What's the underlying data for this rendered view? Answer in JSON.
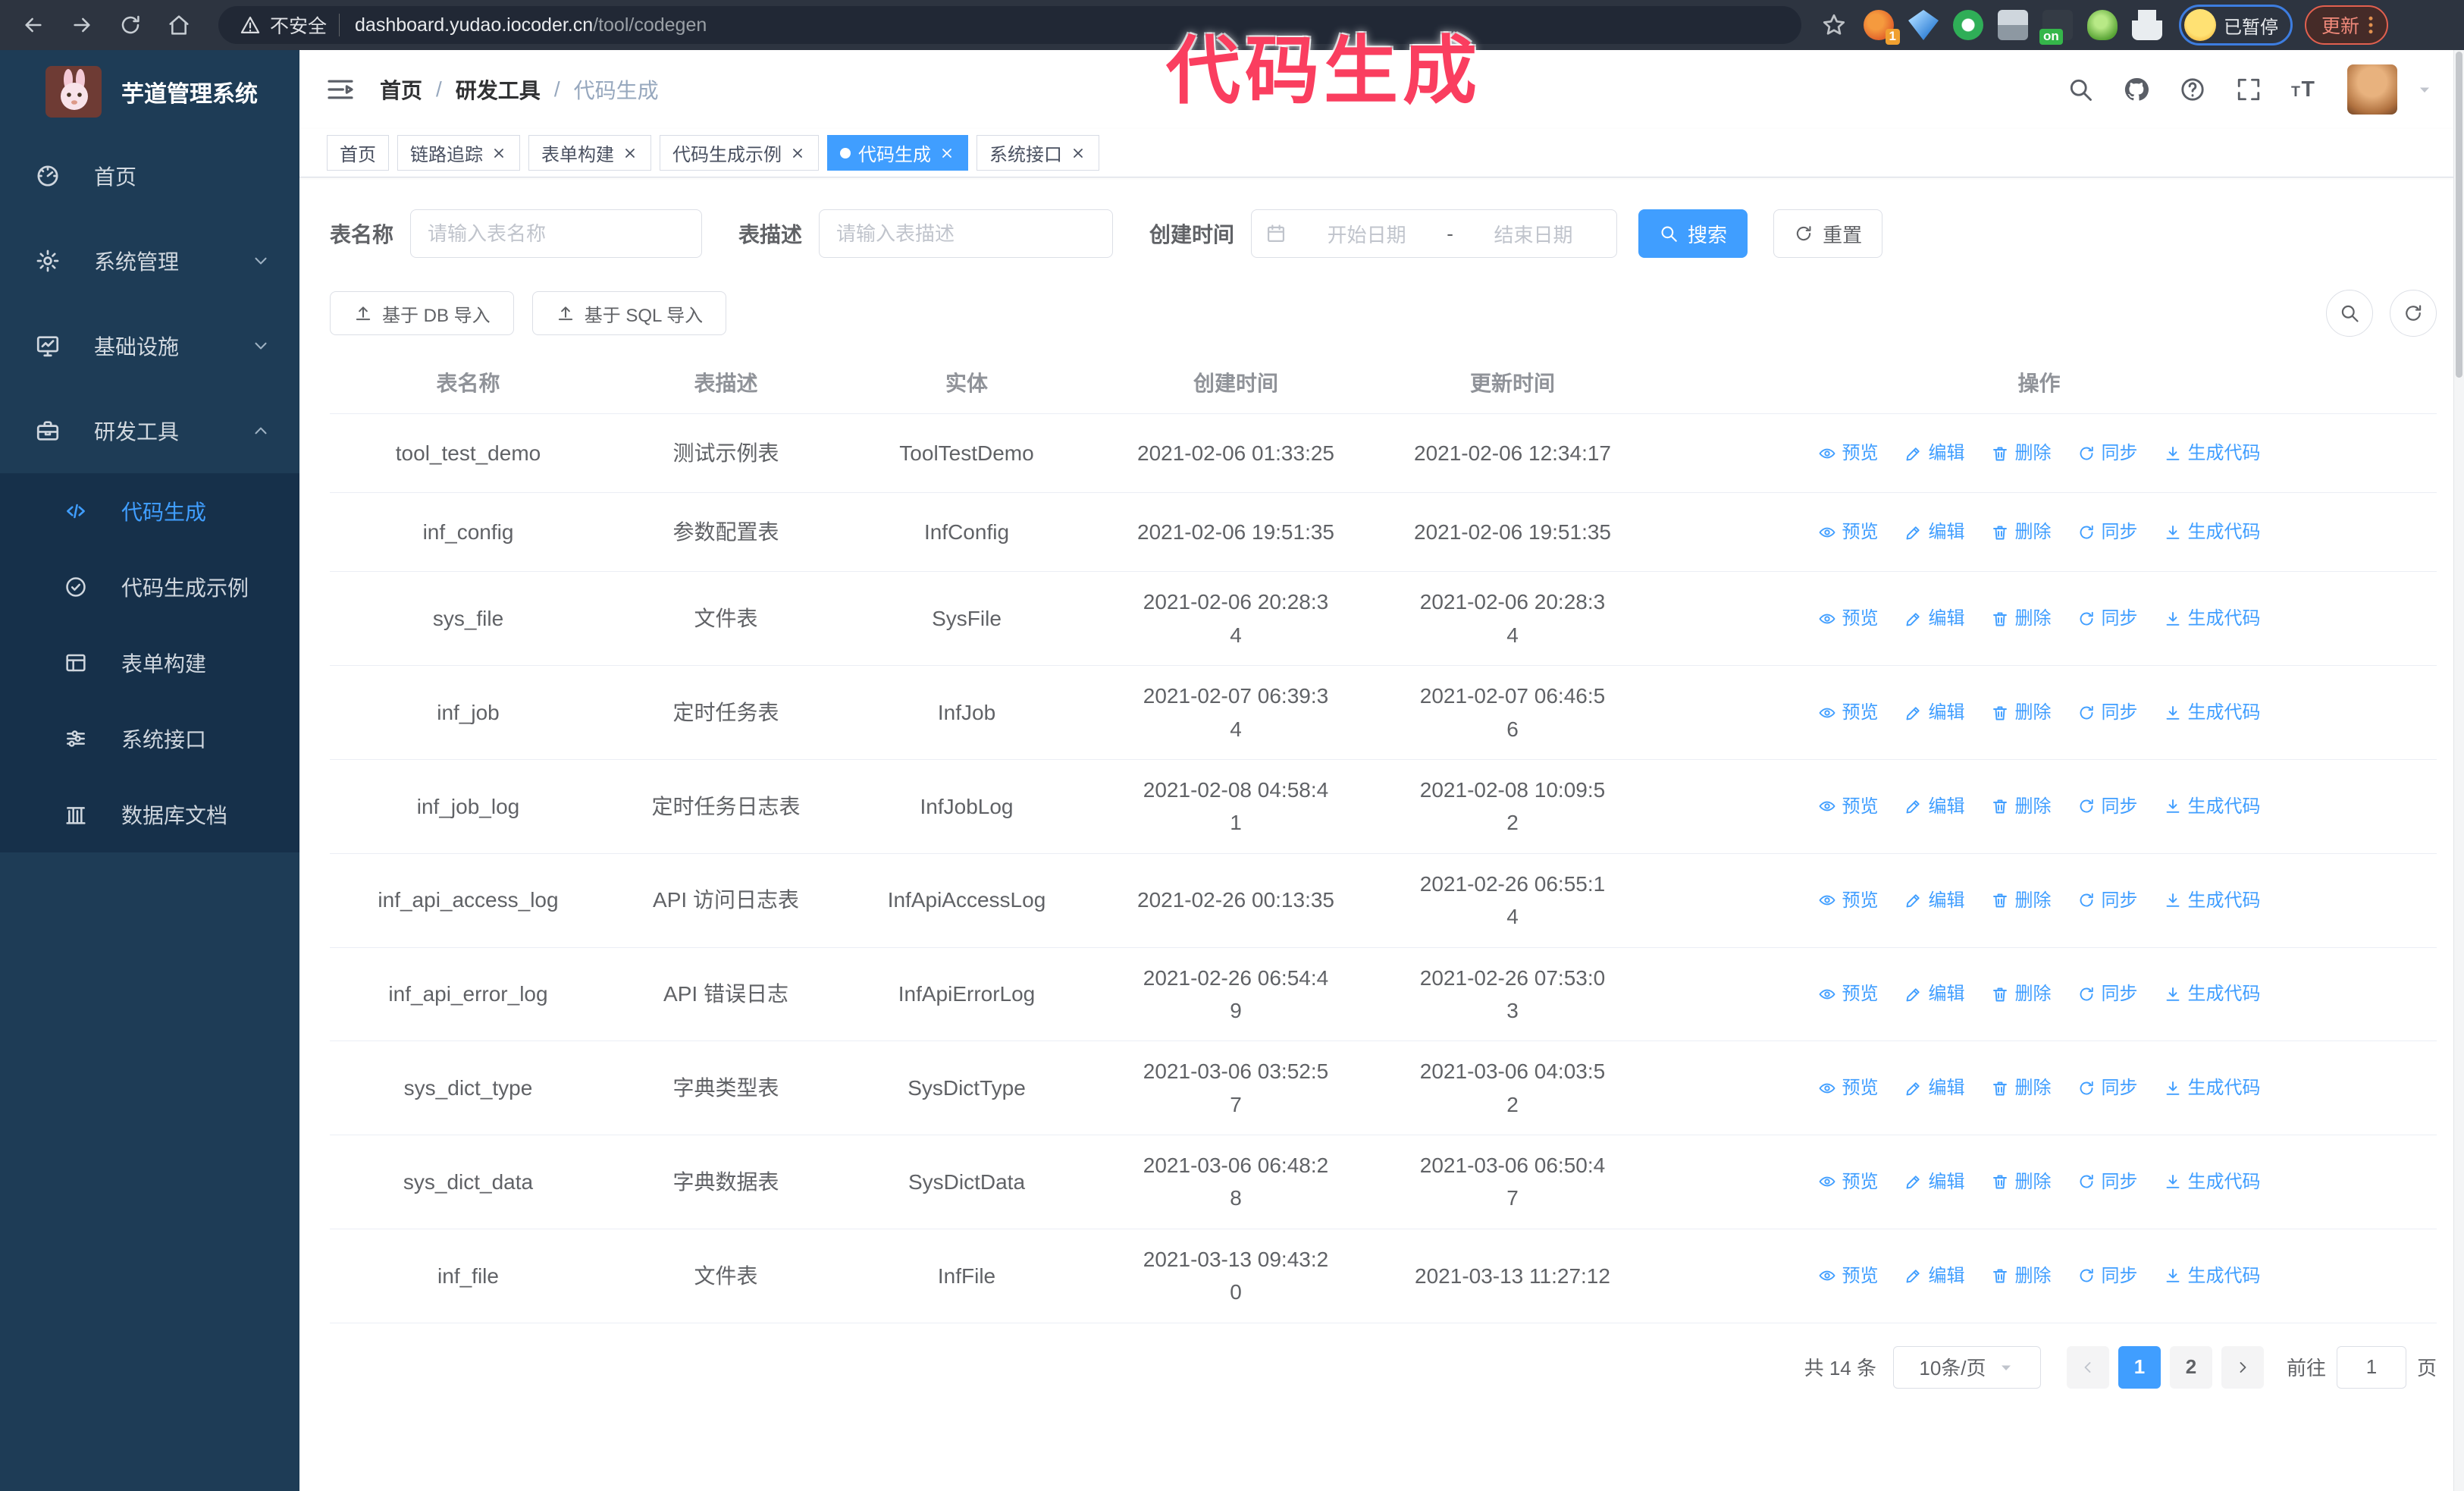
{
  "theme": {
    "accent": "#409eff",
    "annotation": "#fa3e5f",
    "sidebar_bg": "#1e3c56",
    "submenu_bg": "#16304a",
    "toolbar_bg": "#2d3440"
  },
  "annotation": {
    "text": "代码生成"
  },
  "browser": {
    "security_label": "不安全",
    "url_host": "dashboard.yudao.iocoder.cn",
    "url_path": "/tool/codegen",
    "extension_badge": "1",
    "extension_on_badge": "on",
    "paused_label": "已暂停",
    "update_label": "更新"
  },
  "sidebar": {
    "app_title": "芋道管理系统",
    "items": [
      {
        "label": "首页",
        "icon": "dashboard-icon",
        "name": "sidebar-item-home"
      },
      {
        "label": "系统管理",
        "icon": "gear-icon",
        "chevron_down": true,
        "name": "sidebar-item-system"
      },
      {
        "label": "基础设施",
        "icon": "monitor-icon",
        "chevron_down": true,
        "name": "sidebar-item-infra"
      },
      {
        "label": "研发工具",
        "icon": "toolbox-icon",
        "chevron_up": true,
        "name": "sidebar-item-devtools"
      }
    ],
    "sub_items": [
      {
        "label": "代码生成",
        "icon": "code-icon",
        "active": true,
        "name": "sidebar-item-codegen"
      },
      {
        "label": "代码生成示例",
        "icon": "badge-check-icon",
        "name": "sidebar-item-codegen-example"
      },
      {
        "label": "表单构建",
        "icon": "form-icon",
        "name": "sidebar-item-form-builder"
      },
      {
        "label": "系统接口",
        "icon": "sliders-icon",
        "name": "sidebar-item-api"
      },
      {
        "label": "数据库文档",
        "icon": "database-icon",
        "name": "sidebar-item-db-doc"
      }
    ]
  },
  "header": {
    "breadcrumb": [
      {
        "label": "首页",
        "first": true
      },
      {
        "label": "研发工具"
      },
      {
        "label": "代码生成",
        "current": true
      }
    ]
  },
  "tabs": [
    {
      "label": "首页"
    },
    {
      "label": "链路追踪",
      "closable": true
    },
    {
      "label": "表单构建",
      "closable": true
    },
    {
      "label": "代码生成示例",
      "closable": true
    },
    {
      "label": "代码生成",
      "closable": true,
      "active": true
    },
    {
      "label": "系统接口",
      "closable": true
    }
  ],
  "filters": {
    "table_name_label": "表名称",
    "table_name_placeholder": "请输入表名称",
    "table_desc_label": "表描述",
    "table_desc_placeholder": "请输入表描述",
    "create_time_label": "创建时间",
    "start_placeholder": "开始日期",
    "range_separator": "-",
    "end_placeholder": "结束日期",
    "search_label": "搜索",
    "reset_label": "重置"
  },
  "import_toolbar": {
    "db_label": "基于 DB 导入",
    "sql_label": "基于 SQL 导入"
  },
  "table": {
    "columns": [
      "表名称",
      "表描述",
      "实体",
      "创建时间",
      "更新时间",
      "操作"
    ],
    "actions": [
      {
        "name": "preview-action",
        "icon": "eye-icon",
        "label": "预览"
      },
      {
        "name": "edit-action",
        "icon": "edit-icon",
        "label": "编辑"
      },
      {
        "name": "delete-action",
        "icon": "delete-icon",
        "label": "删除"
      },
      {
        "name": "sync-action",
        "icon": "sync-icon",
        "label": "同步"
      },
      {
        "name": "generate-code-action",
        "icon": "download-icon",
        "label": "生成代码"
      }
    ],
    "rows": [
      {
        "name": "tool_test_demo",
        "desc": "测试示例表",
        "entity": "ToolTestDemo",
        "created": "2021-02-06 01:33:25",
        "updated": "2021-02-06 12:34:17"
      },
      {
        "name": "inf_config",
        "desc": "参数配置表",
        "entity": "InfConfig",
        "created": "2021-02-06 19:51:35",
        "updated": "2021-02-06 19:51:35"
      },
      {
        "name": "sys_file",
        "desc": "文件表",
        "entity": "SysFile",
        "created": [
          "2021-02-06 20:28:3",
          "4"
        ],
        "updated": [
          "2021-02-06 20:28:3",
          "4"
        ]
      },
      {
        "name": "inf_job",
        "desc": "定时任务表",
        "entity": "InfJob",
        "created": [
          "2021-02-07 06:39:3",
          "4"
        ],
        "updated": [
          "2021-02-07 06:46:5",
          "6"
        ]
      },
      {
        "name": "inf_job_log",
        "desc": "定时任务日志表",
        "entity": "InfJobLog",
        "created": [
          "2021-02-08 04:58:4",
          "1"
        ],
        "updated": [
          "2021-02-08 10:09:5",
          "2"
        ]
      },
      {
        "name": "inf_api_access_log",
        "desc": "API 访问日志表",
        "entity": "InfApiAccessLog",
        "created": "2021-02-26 00:13:35",
        "updated": [
          "2021-02-26 06:55:1",
          "4"
        ]
      },
      {
        "name": "inf_api_error_log",
        "desc": "API 错误日志",
        "entity": "InfApiErrorLog",
        "created": [
          "2021-02-26 06:54:4",
          "9"
        ],
        "updated": [
          "2021-02-26 07:53:0",
          "3"
        ]
      },
      {
        "name": "sys_dict_type",
        "desc": "字典类型表",
        "entity": "SysDictType",
        "created": [
          "2021-03-06 03:52:5",
          "7"
        ],
        "updated": [
          "2021-03-06 04:03:5",
          "2"
        ]
      },
      {
        "name": "sys_dict_data",
        "desc": "字典数据表",
        "entity": "SysDictData",
        "created": [
          "2021-03-06 06:48:2",
          "8"
        ],
        "updated": [
          "2021-03-06 06:50:4",
          "7"
        ]
      },
      {
        "name": "inf_file",
        "desc": "文件表",
        "entity": "InfFile",
        "created": [
          "2021-03-13 09:43:2",
          "0"
        ],
        "updated": "2021-03-13 11:27:12"
      }
    ]
  },
  "pagination": {
    "total_label": "共 14 条",
    "page_size_label": "10条/页",
    "pages": [
      {
        "label": "1",
        "active": true
      },
      {
        "label": "2"
      }
    ],
    "goto_label": "前往",
    "goto_value": "1",
    "unit_label": "页"
  }
}
